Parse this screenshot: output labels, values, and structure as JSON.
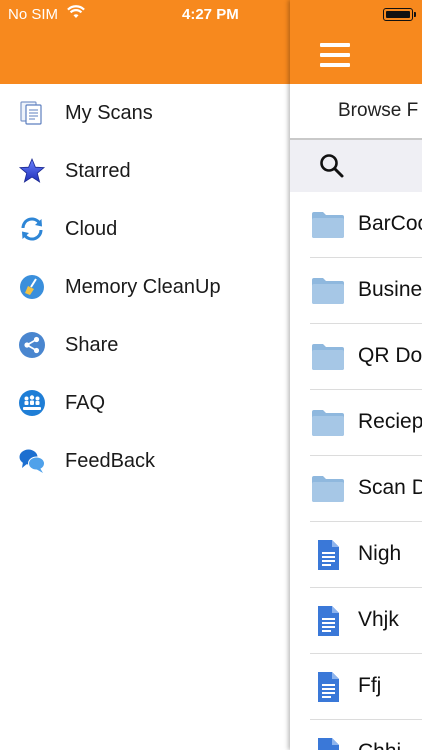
{
  "status_bar": {
    "carrier": "No SIM",
    "time": "4:27 PM",
    "icons": [
      "wifi-icon",
      "battery-icon"
    ]
  },
  "colors": {
    "header_orange": "#f7891e",
    "folder_blue": "#8fb8de",
    "doc_blue": "#3a78d8"
  },
  "menu": {
    "items": [
      {
        "label": "My Scans",
        "icon": "scans-document-icon"
      },
      {
        "label": "Starred",
        "icon": "star-icon"
      },
      {
        "label": "Cloud",
        "icon": "cloud-sync-icon"
      },
      {
        "label": "Memory CleanUp",
        "icon": "broom-icon"
      },
      {
        "label": "Share",
        "icon": "share-icon"
      },
      {
        "label": "FAQ",
        "icon": "about-us-icon"
      },
      {
        "label": "FeedBack",
        "icon": "chat-bubbles-icon"
      }
    ]
  },
  "main": {
    "browse_label": "Browse F",
    "search": {
      "icon": "search-icon",
      "placeholder": ""
    },
    "files": [
      {
        "name": "BarCoo",
        "type": "folder"
      },
      {
        "name": "Busine",
        "type": "folder"
      },
      {
        "name": "QR Do",
        "type": "folder"
      },
      {
        "name": "Reciep",
        "type": "folder"
      },
      {
        "name": "Scan D",
        "type": "folder"
      },
      {
        "name": "Nigh",
        "type": "document"
      },
      {
        "name": "Vhjk",
        "type": "document"
      },
      {
        "name": "Ffj",
        "type": "document"
      },
      {
        "name": "Chhj",
        "type": "document"
      }
    ]
  }
}
